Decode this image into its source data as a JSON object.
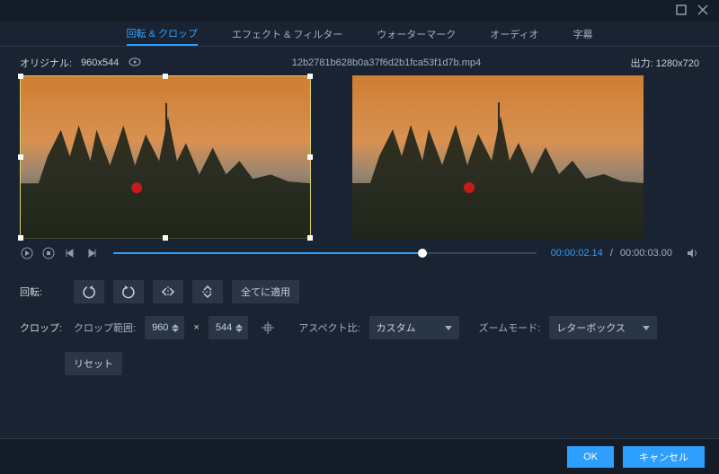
{
  "tabs": {
    "rotate_crop": "回転 & クロップ",
    "effect_filter": "エフェクト & フィルター",
    "watermark": "ウォーターマーク",
    "audio": "オーディオ",
    "subtitle": "字幕"
  },
  "info": {
    "original_label": "オリジナル:",
    "original_size": "960x544",
    "filename": "12b2781b628b0a37f6d2b1fca53f1d7b.mp4",
    "output_label": "出力:",
    "output_size": "1280x720"
  },
  "time": {
    "current": "00:00:02.14",
    "total": "00:00:03.00",
    "sep": "/"
  },
  "rotate": {
    "label": "回転:",
    "apply_all": "全てに適用"
  },
  "crop": {
    "label": "クロップ:",
    "range_label": "クロップ範囲:",
    "width": "960",
    "sep": "×",
    "height": "544",
    "aspect_label": "アスペクト比:",
    "aspect_val": "カスタム",
    "zoom_label": "ズームモード:",
    "zoom_val": "レターボックス",
    "reset": "リセット"
  },
  "footer": {
    "ok": "OK",
    "cancel": "キャンセル"
  }
}
